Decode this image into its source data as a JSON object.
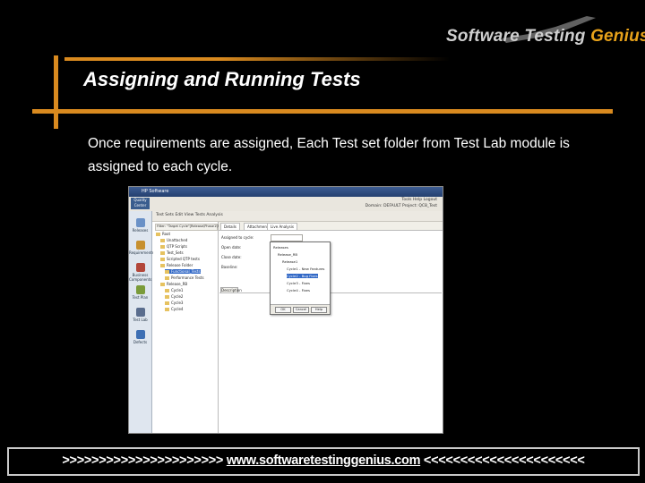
{
  "brand": {
    "part1": "Software Testing",
    "part2": "Genius",
    "accent_color": "#e8a21a"
  },
  "slide": {
    "title": "Assigning and Running Tests",
    "body": "Once requirements are assigned, Each Test set folder from Test Lab module is assigned to each cycle."
  },
  "screenshot": {
    "window_title": "HP Software",
    "app_name": "Quality Center",
    "menu_right_top": "Tools  Help  Logout",
    "menu_right_second": "Domain: DEFAULT  Project: QC8_Test",
    "toolbar": "Test Sets  Edit  View  Tests  Analysis",
    "sidebar_items": [
      {
        "label": "Releases",
        "color": "#6a91c7"
      },
      {
        "label": "Requirements",
        "color": "#c7902f"
      },
      {
        "label": "Business Components",
        "color": "#b2463a"
      },
      {
        "label": "Test Plan",
        "color": "#7a9b3a"
      },
      {
        "label": "Test Lab",
        "color": "#5a6d8e"
      },
      {
        "label": "Defects",
        "color": "#3d6fb4"
      }
    ],
    "tree_filter": "Filter: \"Target Cycle\"[Release\\Phase1\\Test\"]",
    "tree_rows": [
      {
        "label": "Root",
        "indent": 0
      },
      {
        "label": "Unattached",
        "indent": 1
      },
      {
        "label": "QTP Scripts",
        "indent": 1
      },
      {
        "label": "Test_Sets",
        "indent": 1
      },
      {
        "label": "Scripted QTP tests",
        "indent": 1
      },
      {
        "label": "Release Folder",
        "indent": 1
      },
      {
        "label": "Functional_Tests",
        "indent": 2,
        "selected": true
      },
      {
        "label": "Performance Tests",
        "indent": 2
      },
      {
        "label": "Release_RB",
        "indent": 1
      },
      {
        "label": "Cycle1",
        "indent": 2
      },
      {
        "label": "Cycle2",
        "indent": 2
      },
      {
        "label": "Cycle3",
        "indent": 2
      },
      {
        "label": "Cycle4",
        "indent": 2
      }
    ],
    "tabs": [
      "Details",
      "Attachments",
      "Live Analysis"
    ],
    "fields": [
      "Assigned to cycle:",
      "Open date:",
      "Close date:",
      "Baseline:"
    ],
    "description_tab": "Description",
    "popup_rows": [
      {
        "label": "Releases",
        "indent": 0
      },
      {
        "label": "Release_RB",
        "indent": 1
      },
      {
        "label": "Release1",
        "indent": 2
      },
      {
        "label": "Cycle1 - New Features",
        "indent": 3
      },
      {
        "label": "Cycle2 - Bug Fixes",
        "indent": 3,
        "selected": true
      },
      {
        "label": "Cycle3 - Fixes",
        "indent": 3
      },
      {
        "label": "Cycle4 - Fixes",
        "indent": 3
      }
    ],
    "popup_ok": "OK",
    "popup_cancel": "Cancel",
    "popup_help": "Help"
  },
  "footer": {
    "left_arrows": ">>>>>>>>>>>>>>>>>>>>>>",
    "url": "www.softwaretestinggenius.com",
    "right_arrows": "<<<<<<<<<<<<<<<<<<<<<<"
  }
}
